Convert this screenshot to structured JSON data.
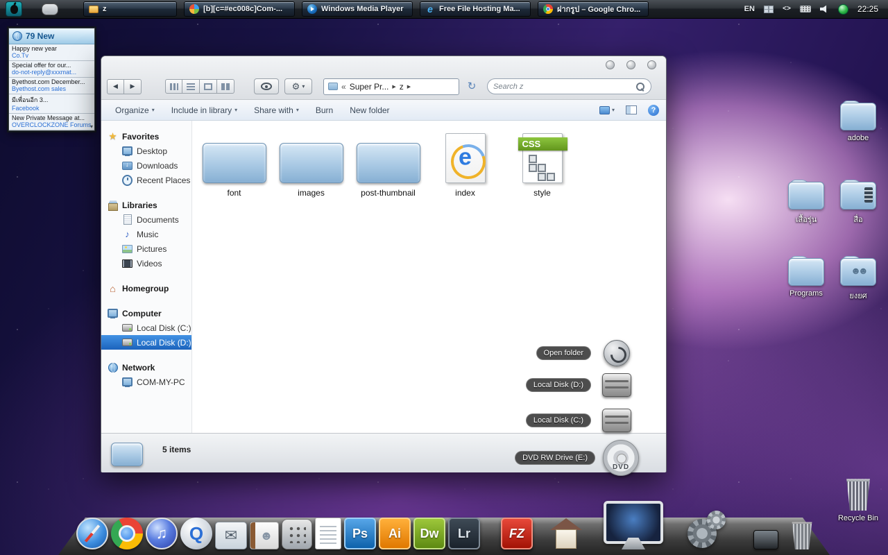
{
  "taskbar": {
    "tray": {
      "language": "EN",
      "clock": "22:25"
    },
    "buttons": [
      {
        "label": "z",
        "icon": "folder-small-icon"
      },
      {
        "label": "[b][c=#ec008c]Com-...",
        "icon": "messenger-icon"
      },
      {
        "label": "Windows Media Player",
        "icon": "wmp-icon"
      },
      {
        "label": "Free File Hosting Ma...",
        "icon": "ie-small-icon"
      },
      {
        "label": "ฝากรูป – Google Chro...",
        "icon": "chrome-small-icon"
      }
    ]
  },
  "notifier": {
    "header": "79 New",
    "items": [
      {
        "title": "Happy new year",
        "source": "Co.Tv"
      },
      {
        "title": "Special offer for our...",
        "source": "do-not-reply@xxxmat..."
      },
      {
        "title": "Byethost.com December...",
        "source": "Byethost.com sales"
      },
      {
        "title": "มีเพื่อนอีก 3...",
        "source": "Facebook"
      },
      {
        "title": "New Private Message at...",
        "source": "OVERCLOCKZONE Forums"
      }
    ]
  },
  "explorer": {
    "breadcrumb": {
      "collapsed": "«",
      "root": "Super Pr...",
      "separator": "▶",
      "current": "z"
    },
    "search": {
      "placeholder": "Search z"
    },
    "commandbar": {
      "items": [
        {
          "label": "Organize",
          "dropdown": true
        },
        {
          "label": "Include in library",
          "dropdown": true
        },
        {
          "label": "Share with",
          "dropdown": true
        },
        {
          "label": "Burn",
          "dropdown": false
        },
        {
          "label": "New folder",
          "dropdown": false
        }
      ],
      "help_label": "?"
    },
    "sidebar": {
      "sections": [
        {
          "label": "Favorites",
          "icon": "favorites-icon",
          "children": [
            {
              "label": "Desktop",
              "icon": "monitor-icon"
            },
            {
              "label": "Downloads",
              "icon": "downloads-icon"
            },
            {
              "label": "Recent Places",
              "icon": "clock-icon"
            }
          ]
        },
        {
          "label": "Libraries",
          "icon": "libraries-icon",
          "children": [
            {
              "label": "Documents",
              "icon": "document-icon"
            },
            {
              "label": "Music",
              "icon": "music-note-icon"
            },
            {
              "label": "Pictures",
              "icon": "pictures-icon"
            },
            {
              "label": "Videos",
              "icon": "videos-icon"
            }
          ]
        },
        {
          "label": "Homegroup",
          "icon": "homegroup-icon",
          "children": []
        },
        {
          "label": "Computer",
          "icon": "computer-icon",
          "children": [
            {
              "label": "Local Disk (C:)",
              "icon": "disk-icon"
            },
            {
              "label": "Local Disk (D:)",
              "icon": "disk-icon",
              "selected": true
            }
          ]
        },
        {
          "label": "Network",
          "icon": "network-icon",
          "children": [
            {
              "label": "COM-MY-PC",
              "icon": "computer-small-icon"
            }
          ]
        }
      ]
    },
    "files": [
      {
        "name": "font",
        "icon": "folder-icon"
      },
      {
        "name": "images",
        "icon": "folder-icon"
      },
      {
        "name": "post-thumbnail",
        "icon": "folder-icon"
      },
      {
        "name": "index",
        "icon": "html-file-icon"
      },
      {
        "name": "style",
        "icon": "css-file-icon",
        "badge": "CSS"
      }
    ],
    "statusbar": {
      "count": "5 items"
    }
  },
  "stack": [
    {
      "label": "Open folder",
      "icon": "open-folder-icon"
    },
    {
      "label": "Local Disk (D:)",
      "icon": "drive-icon"
    },
    {
      "label": "Local Disk (C:)",
      "icon": "drive-icon"
    },
    {
      "label": "DVD RW Drive (E:)",
      "icon": "dvd-icon",
      "disc_text": "DVD"
    }
  ],
  "desktop_icons": [
    {
      "label": "adobe",
      "icon": "folder-icon"
    },
    {
      "label": "เสื้อรุ่น",
      "icon": "folder-icon"
    },
    {
      "label": "สื่อ",
      "icon": "media-folder-icon"
    },
    {
      "label": "Programs",
      "icon": "folder-icon"
    },
    {
      "label": "ยงยศ",
      "icon": "users-folder-icon"
    },
    {
      "label": "Recycle Bin",
      "icon": "recycle-bin-icon"
    }
  ],
  "dock": {
    "items": [
      {
        "icon": "safari-icon"
      },
      {
        "icon": "chrome-icon"
      },
      {
        "icon": "itunes-icon"
      },
      {
        "icon": "quicktime-icon"
      },
      {
        "icon": "mail-icon"
      },
      {
        "icon": "contacts-icon"
      },
      {
        "icon": "calculator-icon"
      },
      {
        "icon": "textedit-icon"
      },
      {
        "icon": "photoshop-icon",
        "text": "Ps"
      },
      {
        "icon": "illustrator-icon",
        "text": "Ai"
      },
      {
        "icon": "dreamweaver-icon",
        "text": "Dw"
      },
      {
        "icon": "lightroom-icon",
        "text": "Lr"
      },
      {
        "icon": "filezilla-icon",
        "text": "FZ"
      },
      {
        "icon": "home-icon"
      },
      {
        "icon": "imac-icon"
      },
      {
        "icon": "system-preferences-icon"
      },
      {
        "icon": "media-small-icon"
      },
      {
        "icon": "trash-small-icon"
      }
    ]
  },
  "colors": {
    "selection_blue": "#2f7fe0",
    "css_green": "#6ab023"
  }
}
